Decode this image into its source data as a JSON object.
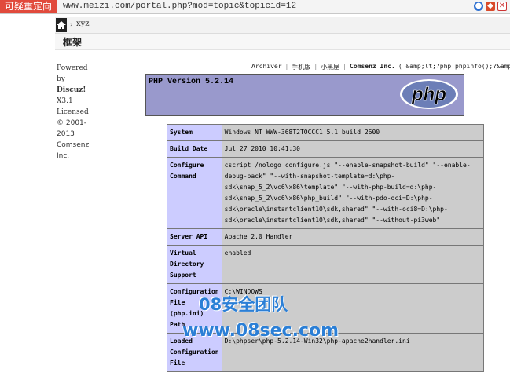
{
  "browser": {
    "redirect_label": "可疑重定向",
    "url": "www.meizi.com/portal.php?mod=topic&topicid=12"
  },
  "breadcrumb": {
    "separator": "›",
    "item": "xyz"
  },
  "frame": {
    "title": "框架"
  },
  "sidebar": {
    "lines": [
      "Powered",
      "by",
      "Discuz!",
      "X3.1",
      "Licensed",
      "© 2001-",
      "2013",
      "Comsenz",
      "Inc."
    ]
  },
  "topnav": {
    "archiver": "Archiver",
    "mobile": "手机版",
    "blackroom": "小黑屋",
    "company": "Comsenz Inc.",
    "code": "( &amp;lt;?php phpinfo();?&amp;gt"
  },
  "phpinfo": {
    "version": "PHP Version 5.2.14",
    "logo_text": "php",
    "logo_bg": "#6c7eb7",
    "header_bg": "#9999cc",
    "rows": [
      {
        "key": "System",
        "value": "Windows NT WWW-368T2TOCCC1 5.1 build 2600"
      },
      {
        "key": "Build Date",
        "value": "Jul 27 2010 10:41:30"
      },
      {
        "key": "Configure Command",
        "value": "cscript /nologo configure.js \"--enable-snapshot-build\" \"--enable-debug-pack\" \"--with-snapshot-template=d:\\php-sdk\\snap_5_2\\vc6\\x86\\template\" \"--with-php-build=d:\\php-sdk\\snap_5_2\\vc6\\x86\\php_build\" \"--with-pdo-oci=D:\\php-sdk\\oracle\\instantclient10\\sdk,shared\" \"--with-oci8=D:\\php-sdk\\oracle\\instantclient10\\sdk,shared\" \"--without-pi3web\""
      },
      {
        "key": "Server API",
        "value": "Apache 2.0 Handler"
      },
      {
        "key": "Virtual Directory Support",
        "value": "enabled"
      },
      {
        "key": "Configuration File (php.ini) Path",
        "value": "C:\\WINDOWS"
      },
      {
        "key": "Loaded Configuration File",
        "value": "D:\\phpser\\php-5.2.14-Win32\\php-apache2handler.ini"
      }
    ]
  },
  "watermark": {
    "line1": "08安全团队",
    "line2": "www.08sec.com"
  }
}
